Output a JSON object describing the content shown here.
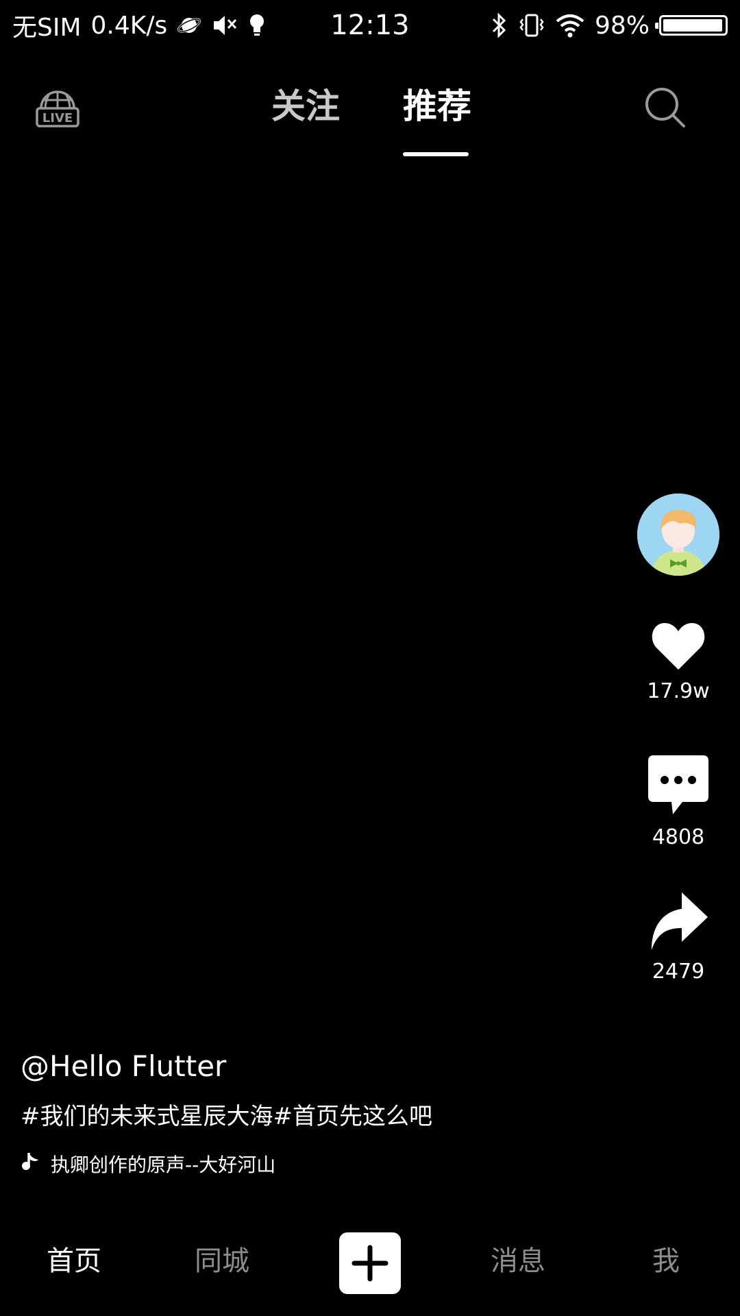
{
  "status_bar": {
    "carrier": "无SIM",
    "speed": "0.4K/s",
    "time": "12:13",
    "battery_text": "98%",
    "battery_level": 0.98,
    "icons": [
      "planet-icon",
      "speaker-mute-icon",
      "lightbulb-icon",
      "bluetooth-icon",
      "vibrate-icon",
      "wifi-icon",
      "battery-icon"
    ]
  },
  "top_nav": {
    "live_icon": "live-globe-icon",
    "tabs": [
      {
        "label": "关注",
        "active": false
      },
      {
        "label": "推荐",
        "active": true
      }
    ],
    "search_icon": "search-icon"
  },
  "actions": {
    "like_count": "17.9w",
    "comment_count": "4808",
    "share_count": "2479"
  },
  "video": {
    "author": "@Hello Flutter",
    "description": "#我们的未来式星辰大海#首页先这么吧",
    "music": "执卿创作的原声--大好河山"
  },
  "bottom_nav": {
    "items": [
      {
        "label": "首页",
        "active": true
      },
      {
        "label": "同城",
        "active": false
      },
      {
        "label": "消息",
        "active": false
      },
      {
        "label": "我",
        "active": false
      }
    ],
    "add_icon": "plus-icon"
  },
  "colors": {
    "background": "#000000",
    "active_text": "#ffffff",
    "inactive_tab": "#c9c9c9",
    "inactive_nav": "#8d8d8d",
    "avatar_bg": "#9cd6f3"
  }
}
